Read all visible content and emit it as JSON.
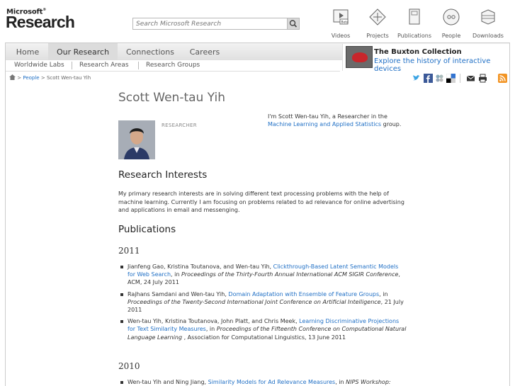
{
  "brand": {
    "small": "Microsoft",
    "big": "Research"
  },
  "search": {
    "placeholder": "Search Microsoft Research"
  },
  "topnav": [
    {
      "label": "Videos",
      "icon": "video-icon"
    },
    {
      "label": "Projects",
      "icon": "projects-icon"
    },
    {
      "label": "Publications",
      "icon": "publications-icon"
    },
    {
      "label": "People",
      "icon": "people-icon"
    },
    {
      "label": "Downloads",
      "icon": "downloads-icon"
    }
  ],
  "tabs": [
    "Home",
    "Our Research",
    "Connections",
    "Careers"
  ],
  "active_tab": "Our Research",
  "subtabs": [
    "Worldwide Labs",
    "Research Areas",
    "Research Groups"
  ],
  "promo": {
    "title": "The Buxton Collection",
    "link": "Explore the history of interactive devices"
  },
  "breadcrumb": {
    "people": "People",
    "sep1": ">",
    "sep2": ">",
    "current": "Scott Wen-tau Yih"
  },
  "profile": {
    "name": "Scott Wen-tau Yih",
    "role": "RESEARCHER",
    "intro_pre": "I'm Scott Wen-tau Yih, a Researcher in the",
    "intro_link": "Machine Learning and Applied Statistics",
    "intro_post": "group."
  },
  "interests": {
    "heading": "Research Interests",
    "text": "My primary research interests are in solving different text processing problems with the help of machine learning. Currently I am focusing on problems related to ad relevance for online advertising and applications in email and messenging."
  },
  "publications": {
    "heading": "Publications",
    "years": [
      {
        "year": "2011",
        "items": [
          {
            "authors": "Jianfeng Gao, Kristina Toutanova, and Wen-tau Yih,",
            "title": "Clickthrough-Based Latent Semantic Models for Web Search",
            "in": ", in",
            "venue": "Proceedings of the Thirty-Fourth Annual International ACM SIGIR Conference",
            "rest": ", ACM, 24 July 2011"
          },
          {
            "authors": "Rajhans Samdani and Wen-tau Yih,",
            "title": "Domain Adaptation with Ensemble of Feature Groups",
            "in": ", in",
            "venue": "Proceedings of the Twenty-Second International Joint Conference on Artificial Intelligence",
            "rest": ", 21 July 2011"
          },
          {
            "authors": "Wen-tau Yih, Kristina Toutanova, John Platt, and Chris Meek,",
            "title": "Learning Discriminative Projections for Text Similarity Measures",
            "in": ", in",
            "venue": "Proceedings of the Fifteenth Conference on Computational Natural Language Learning",
            "rest": " , Association for Computational Linguistics, 13 June 2011"
          }
        ]
      },
      {
        "year": "2010",
        "items": [
          {
            "authors": "Wen-tau Yih and Ning Jiang,",
            "title": "Similarity Models for Ad Relevance Measures",
            "in": ", in",
            "venue": "NIPS Workshop:",
            "rest": ""
          }
        ]
      }
    ]
  },
  "colors": {
    "link": "#1f6fc5",
    "promo_red": "#c8262b"
  }
}
